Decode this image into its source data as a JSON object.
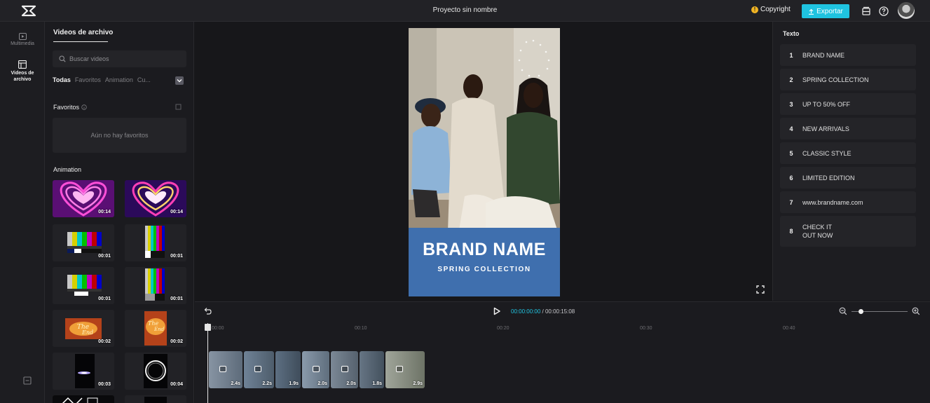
{
  "app": {
    "project_title": "Proyecto sin nombre",
    "copyright_label": "Copyright",
    "export_label": "Exportar",
    "accent": "#1fc3e0"
  },
  "rail": {
    "items": [
      {
        "label": "Multimedia",
        "icon": "media-icon"
      },
      {
        "label": "Videos de archivo",
        "icon": "stock-video-icon"
      }
    ]
  },
  "panel": {
    "tab_title": "Videos de archivo",
    "search_placeholder": "Buscar videos",
    "filters": [
      "Todas",
      "Favoritos",
      "Animation",
      "Cu..."
    ],
    "favorites_label": "Favoritos",
    "favorites_empty": "Aún no hay favoritos",
    "section_label": "Animation",
    "thumbnails": [
      {
        "kind": "heart-neon",
        "duration": "00:14"
      },
      {
        "kind": "heart-neon",
        "duration": "00:14"
      },
      {
        "kind": "color-bars",
        "duration": "00:01"
      },
      {
        "kind": "color-bars-vertical",
        "duration": "00:01"
      },
      {
        "kind": "color-bars",
        "duration": "00:01"
      },
      {
        "kind": "color-bars-vertical",
        "duration": "00:01"
      },
      {
        "kind": "the-end",
        "duration": "00:02"
      },
      {
        "kind": "the-end-vertical",
        "duration": "00:02"
      },
      {
        "kind": "light-streak",
        "duration": "00:03"
      },
      {
        "kind": "ring",
        "duration": "00:04"
      }
    ]
  },
  "preview": {
    "brand_name": "BRAND NAME",
    "brand_sub": "SPRING COLLECTION"
  },
  "textpanel": {
    "title": "Texto",
    "items": [
      {
        "num": "1",
        "text": "BRAND NAME"
      },
      {
        "num": "2",
        "text": "SPRING COLLECTION"
      },
      {
        "num": "3",
        "text": "UP TO 50% OFF"
      },
      {
        "num": "4",
        "text": "NEW ARRIVALS"
      },
      {
        "num": "5",
        "text": "CLASSIC STYLE"
      },
      {
        "num": "6",
        "text": "LIMITED EDITION"
      },
      {
        "num": "7",
        "text": "www.brandname.com"
      },
      {
        "num": "8",
        "text": "CHECK IT\nOUT NOW"
      }
    ]
  },
  "timeline": {
    "current_time": "00:00:00:00",
    "total_time": "00:00:15:08",
    "ruler": [
      "00:00",
      "00:10",
      "00:20",
      "00:30",
      "00:40"
    ],
    "clips": [
      {
        "duration": "2.4s",
        "icon": true
      },
      {
        "duration": "2.2s",
        "icon": true
      },
      {
        "duration": "1.9s",
        "icon": false
      },
      {
        "duration": "2.0s",
        "icon": true
      },
      {
        "duration": "2.0s",
        "icon": true
      },
      {
        "duration": "1.8s",
        "icon": false
      },
      {
        "duration": "2.9s",
        "icon": true
      }
    ]
  }
}
